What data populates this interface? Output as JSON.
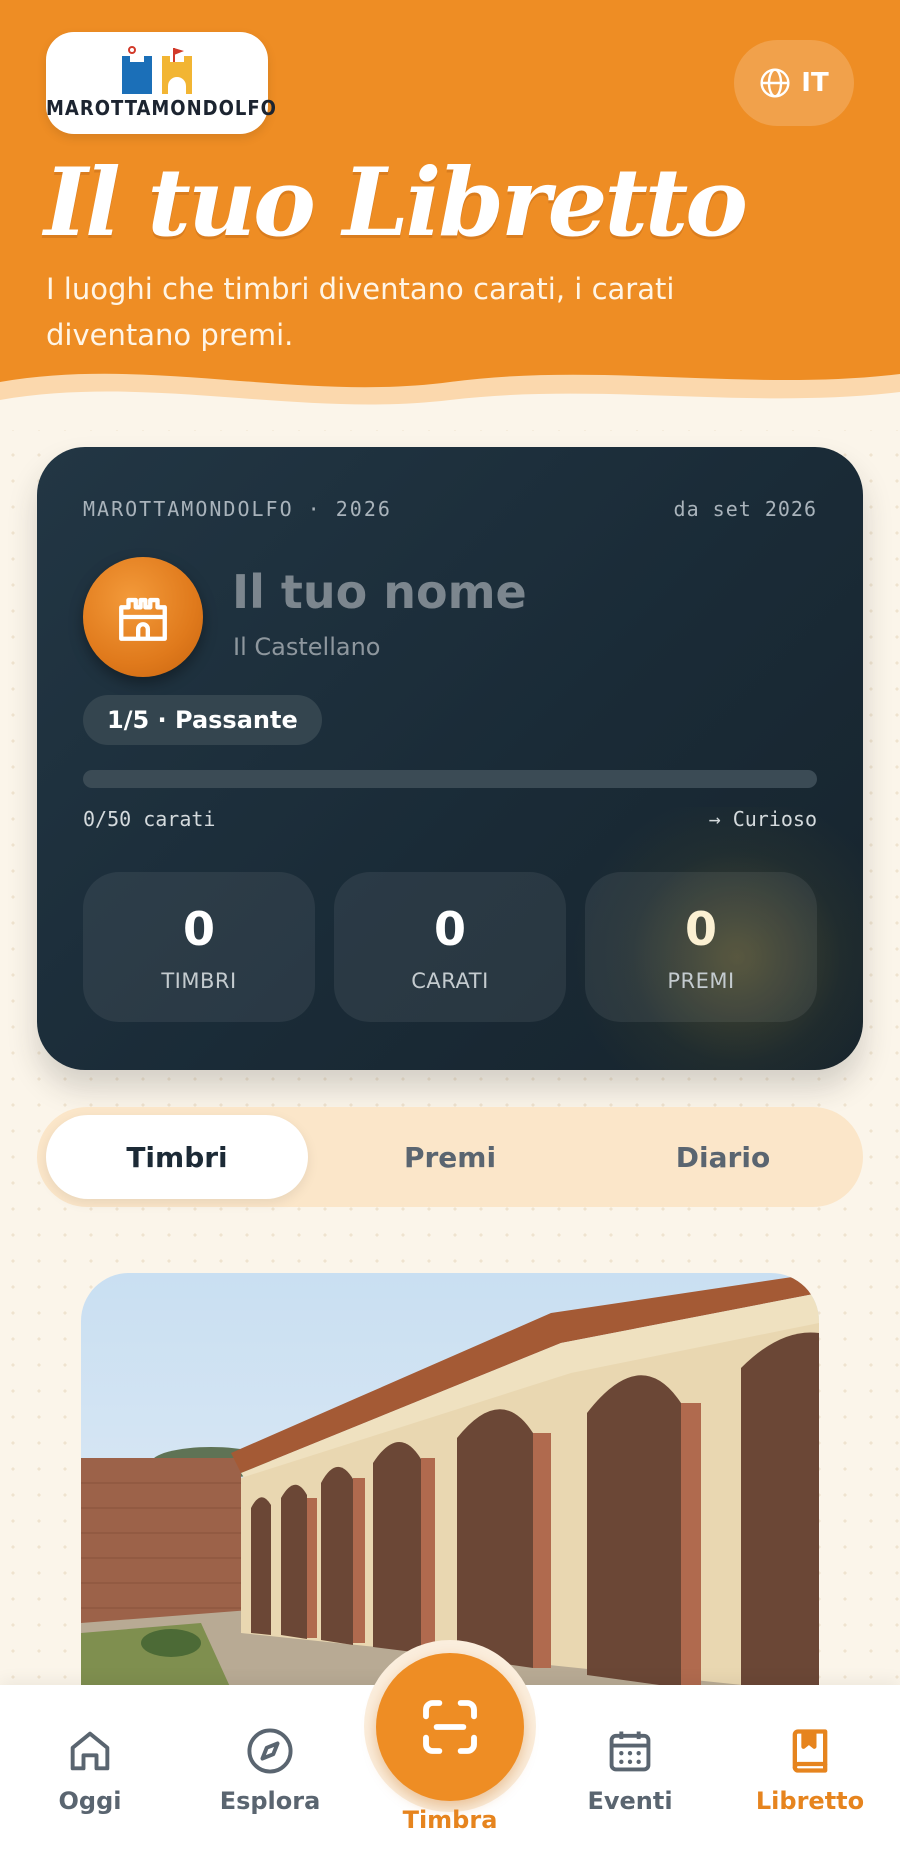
{
  "header": {
    "logo_text": "MAROTTAMONDOLFO",
    "language_label": "IT",
    "title": "Il tuo Libretto",
    "subtitle": "I luoghi che timbri diventano carati, i carati diventano premi."
  },
  "passport": {
    "place_year": "MAROTTAMONDOLFO · 2026",
    "since": "da set 2026",
    "name": "Il tuo nome",
    "role": "Il Castellano",
    "level_badge": "1/5 · Passante",
    "progress_fraction": 0,
    "progress_text": "0/50 carati",
    "next_level": "→ Curioso",
    "stats": [
      {
        "value": "0",
        "label": "TIMBRI"
      },
      {
        "value": "0",
        "label": "CARATI"
      },
      {
        "value": "0",
        "label": "PREMI"
      }
    ]
  },
  "tabs": [
    {
      "label": "Timbri",
      "active": true
    },
    {
      "label": "Premi",
      "active": false
    },
    {
      "label": "Diario",
      "active": false
    }
  ],
  "nav": {
    "items": [
      {
        "label": "Oggi",
        "icon": "home-icon"
      },
      {
        "label": "Esplora",
        "icon": "compass-icon"
      },
      {
        "label": "Timbra",
        "icon": "scan-icon"
      },
      {
        "label": "Eventi",
        "icon": "calendar-icon"
      },
      {
        "label": "Libretto",
        "icon": "book-icon"
      }
    ],
    "active": "Libretto"
  },
  "colors": {
    "accent": "#ee8d24",
    "card_bg": "#1d2e3a",
    "page_bg": "#fbf5ea"
  }
}
